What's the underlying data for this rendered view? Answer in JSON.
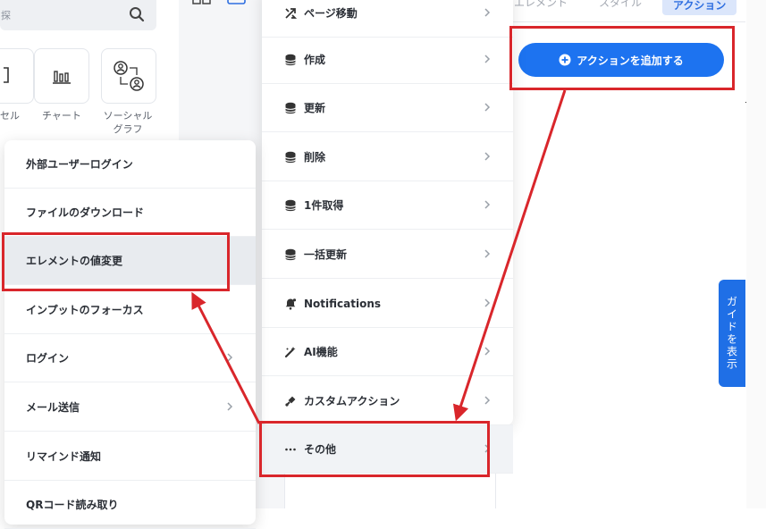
{
  "left_panel": {
    "search_placeholder": "探",
    "tiles": [
      {
        "label": "セル"
      },
      {
        "label": "チャート"
      },
      {
        "label": "ソーシャル\nグラフ"
      }
    ]
  },
  "right_panel": {
    "tabs": [
      "エレメント",
      "スタイル",
      "アクション"
    ],
    "add_action_label": "アクションを追加する",
    "guide_label": "ガイドを表示"
  },
  "action_menu": {
    "items": [
      {
        "label": "ページ移動",
        "icon": "page-move-icon"
      },
      {
        "label": "作成",
        "icon": "database-icon"
      },
      {
        "label": "更新",
        "icon": "database-icon"
      },
      {
        "label": "削除",
        "icon": "database-icon"
      },
      {
        "label": "1件取得",
        "icon": "database-icon"
      },
      {
        "label": "一括更新",
        "icon": "database-icon"
      },
      {
        "label": "Notifications",
        "icon": "bell-icon"
      },
      {
        "label": "AI機能",
        "icon": "ai-magic-icon"
      },
      {
        "label": "カスタムアクション",
        "icon": "custom-action-icon"
      },
      {
        "label": "その他",
        "icon": "more-icon"
      }
    ]
  },
  "sub_menu": {
    "items": [
      {
        "label": "外部ユーザーログイン"
      },
      {
        "label": "ファイルのダウンロード"
      },
      {
        "label": "エレメントの値変更"
      },
      {
        "label": "インプットのフォーカス"
      },
      {
        "label": "ログイン"
      },
      {
        "label": "メール送信"
      },
      {
        "label": "リマインド通知"
      },
      {
        "label": "QRコード読み取り"
      }
    ]
  },
  "colors": {
    "accent": "#1d73f0",
    "annotation": "#d9262b"
  }
}
